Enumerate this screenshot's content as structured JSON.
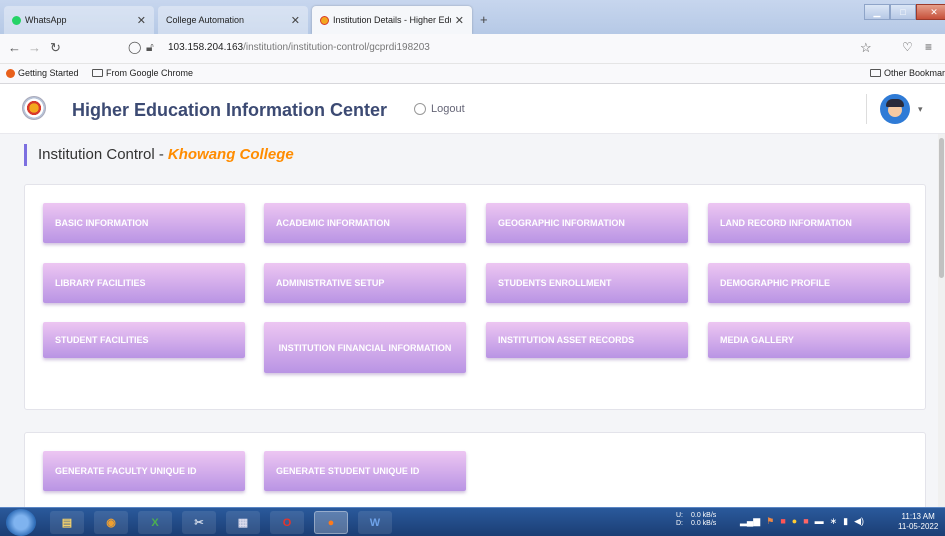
{
  "browser": {
    "tabs": [
      {
        "label": "WhatsApp"
      },
      {
        "label": "College Automation"
      },
      {
        "label": "Institution Details - Higher Educ"
      }
    ],
    "url_host": "103.158.204.163",
    "url_path": "/institution/institution-control/gcprdi198203",
    "bookmarks": [
      "Getting Started",
      "From Google Chrome"
    ],
    "other_bookmarks": "Other Bookmarks"
  },
  "header": {
    "title": "Higher Education Information Center",
    "logout": "Logout"
  },
  "page": {
    "heading": "Institution Control - ",
    "college": "Khowang College"
  },
  "buttons_main": [
    "BASIC INFORMATION",
    "ACADEMIC INFORMATION",
    "GEOGRAPHIC INFORMATION",
    "LAND RECORD INFORMATION",
    "LIBRARY FACILITIES",
    "ADMINISTRATIVE SETUP",
    "STUDENTS ENROLLMENT",
    "DEMOGRAPHIC PROFILE",
    "STUDENT FACILITIES",
    "INSTITUTION FINANCIAL INFORMATION",
    "INSTITUTION ASSET RECORDS",
    "MEDIA GALLERY"
  ],
  "buttons_ids": [
    "GENERATE FACULTY UNIQUE ID",
    "GENERATE STUDENT UNIQUE ID"
  ],
  "taskbar": {
    "net_up": "0.0 kB/s",
    "net_down": "0.0 kB/s",
    "net_labels": [
      "U:",
      "D:"
    ],
    "time": "11:13 AM",
    "date": "11-05-2022"
  },
  "colors": {
    "accent": "#7c6fe0",
    "college": "#ff8c00",
    "button_top": "#edc6f2",
    "button_bottom": "#b994e4"
  }
}
